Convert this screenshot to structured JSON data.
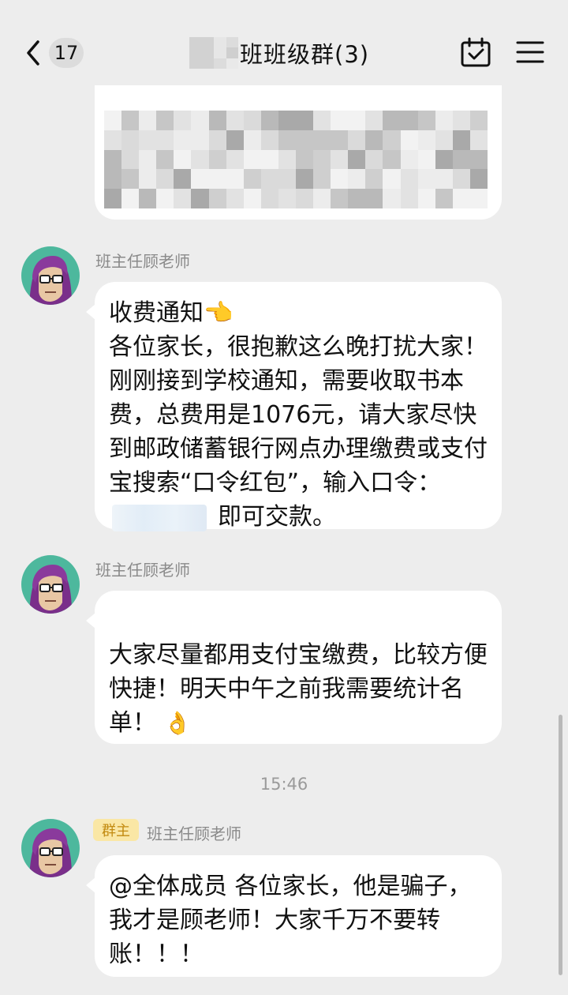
{
  "header": {
    "back_count": "17",
    "title": "班班级群(3)",
    "calendar_icon": "calendar-check-icon",
    "menu_icon": "hamburger-menu-icon"
  },
  "colors": {
    "background": "#ededed",
    "bubble": "#ffffff",
    "owner_tag_bg": "#fae7a5",
    "owner_tag_text": "#c28a10"
  },
  "messages": [
    {
      "sender": "班主任顾老师",
      "line1": "收费通知👈",
      "body": "各位家长，很抱歉这么晚打扰大家！刚刚接到学校通知，需要收取书本费，总费用是1076元，请大家尽快到邮政储蓄银行网点办理缴费或支付宝搜索“口令红包”，输入口令：",
      "tail": "即可交款。"
    },
    {
      "sender": "班主任顾老师",
      "text": "大家尽量都用支付宝缴费，比较方便快捷！明天中午之前我需要统计名单！",
      "emoji": "👌"
    },
    {
      "sender": "班主任顾老师",
      "tag": "群主",
      "text": "@全体成员 各位家长，他是骗子，我才是顾老师！大家千万不要转账！！！"
    }
  ],
  "timestamp": "15:46"
}
